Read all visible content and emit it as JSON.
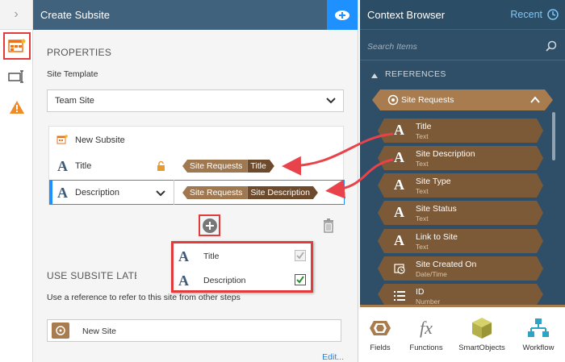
{
  "panel": {
    "title": "Create Subsite",
    "properties_label": "PROPERTIES",
    "site_template_label": "Site Template",
    "site_template_value": "Team Site",
    "rows": {
      "new_subsite": "New Subsite",
      "title_label": "Title",
      "description_label": "Description"
    },
    "tags": {
      "title": {
        "source": "Site Requests",
        "field": "Title"
      },
      "description": {
        "source": "Site Requests",
        "field": "Site Description"
      }
    },
    "popup": {
      "items": [
        {
          "label": "Title",
          "checked": true,
          "enabled": false
        },
        {
          "label": "Description",
          "checked": true,
          "enabled": true
        }
      ]
    },
    "use_later_label": "USE SUBSITE LATER",
    "use_later_desc": "Use a reference to refer to this site from other steps",
    "new_site_value": "New Site",
    "edit_link": "Edit..."
  },
  "context_browser": {
    "title": "Context Browser",
    "recent": "Recent",
    "search_placeholder": "Search Items",
    "references_label": "REFERENCES",
    "group_label": "Site Requests",
    "items": [
      {
        "name": "Title",
        "type": "Text",
        "icon": "text-icon"
      },
      {
        "name": "Site Description",
        "type": "Text",
        "icon": "text-icon"
      },
      {
        "name": "Site Type",
        "type": "Text",
        "icon": "text-icon"
      },
      {
        "name": "Site Status",
        "type": "Text",
        "icon": "text-icon"
      },
      {
        "name": "Link to Site",
        "type": "Text",
        "icon": "text-icon"
      },
      {
        "name": "Site Created On",
        "type": "Date/Time",
        "icon": "clock-icon"
      },
      {
        "name": "ID",
        "type": "Number",
        "icon": "number-icon"
      }
    ],
    "tabs": [
      {
        "label": "Fields"
      },
      {
        "label": "Functions"
      },
      {
        "label": "SmartObjects"
      },
      {
        "label": "Workflow"
      }
    ]
  },
  "colors": {
    "header": "#40627d",
    "accent_blue": "#1e90ff",
    "reference_brown": "#7d5a37",
    "highlight_red": "#e03c3c"
  }
}
